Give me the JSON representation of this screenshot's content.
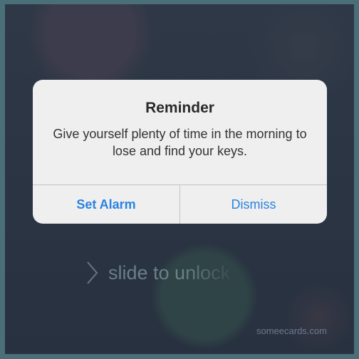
{
  "alert": {
    "title": "Reminder",
    "message": "Give yourself plenty of time in the morning to lose and find your keys.",
    "buttons": [
      "Set Alarm",
      "Dismiss"
    ]
  },
  "lockscreen": {
    "slide_label": "slide to unlock"
  },
  "watermark": "someecards.com",
  "colors": {
    "accent": "#2a83e0",
    "frame": "#4b6f78"
  }
}
